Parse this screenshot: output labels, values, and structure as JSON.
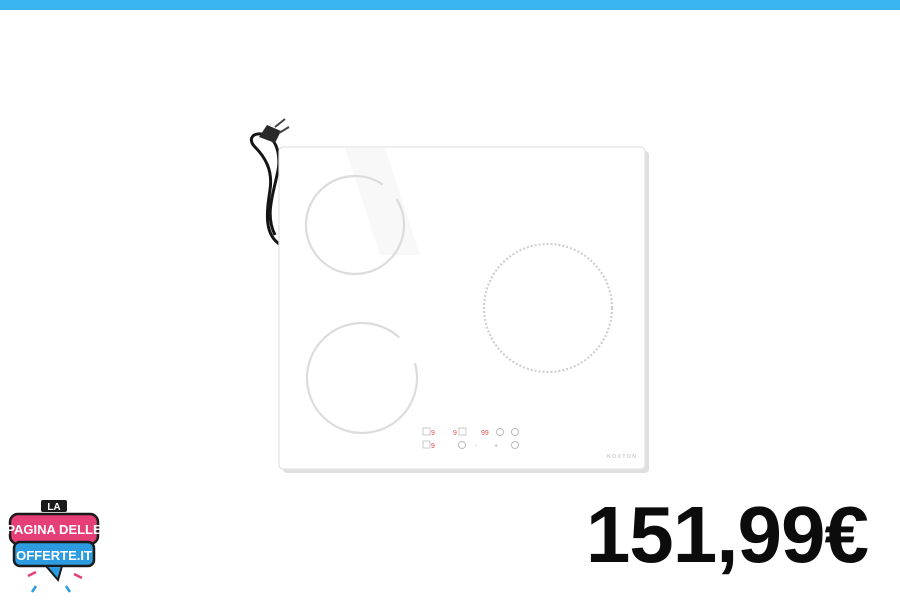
{
  "header": {
    "accent_color": "#3bb4f2"
  },
  "product": {
    "brand": "NOXTON",
    "panel": {
      "row1": [
        "9",
        "9",
        "99"
      ],
      "row2": [
        "9",
        "-",
        "+"
      ]
    },
    "price": "151,99€"
  },
  "logo": {
    "line1": "LA",
    "line2": "PAGINA DELLE",
    "line3": "OFFERTE.IT",
    "colors": {
      "pink": "#e63f78",
      "blue": "#2c9be0",
      "dark": "#1a1a1a"
    }
  }
}
